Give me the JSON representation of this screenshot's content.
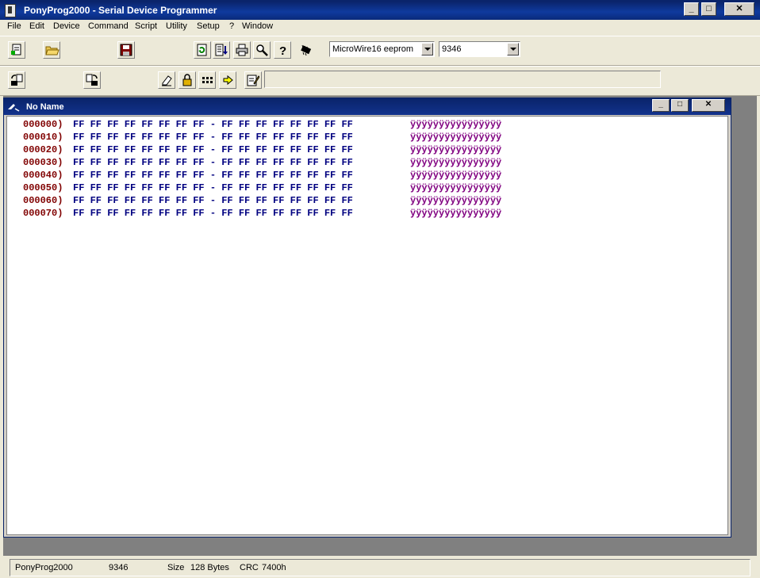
{
  "window": {
    "title": "PonyProg2000 - Serial Device Programmer",
    "minimize": "_",
    "maximize": "□",
    "close": "✕"
  },
  "menu": {
    "items": [
      "File",
      "Edit",
      "Device",
      "Command",
      "Script",
      "Utility",
      "Setup",
      "?",
      "Window"
    ]
  },
  "toolbar": {
    "device_family": "MicroWire16 eeprom",
    "device_type": "9346",
    "note_text": ""
  },
  "document": {
    "title": "No Name",
    "rows": [
      {
        "addr": "000000)",
        "bytes": "FF FF FF FF FF FF FF FF - FF FF FF FF FF FF FF FF",
        "ascii": "ÿÿÿÿÿÿÿÿÿÿÿÿÿÿÿÿ"
      },
      {
        "addr": "000010)",
        "bytes": "FF FF FF FF FF FF FF FF - FF FF FF FF FF FF FF FF",
        "ascii": "ÿÿÿÿÿÿÿÿÿÿÿÿÿÿÿÿ"
      },
      {
        "addr": "000020)",
        "bytes": "FF FF FF FF FF FF FF FF - FF FF FF FF FF FF FF FF",
        "ascii": "ÿÿÿÿÿÿÿÿÿÿÿÿÿÿÿÿ"
      },
      {
        "addr": "000030)",
        "bytes": "FF FF FF FF FF FF FF FF - FF FF FF FF FF FF FF FF",
        "ascii": "ÿÿÿÿÿÿÿÿÿÿÿÿÿÿÿÿ"
      },
      {
        "addr": "000040)",
        "bytes": "FF FF FF FF FF FF FF FF - FF FF FF FF FF FF FF FF",
        "ascii": "ÿÿÿÿÿÿÿÿÿÿÿÿÿÿÿÿ"
      },
      {
        "addr": "000050)",
        "bytes": "FF FF FF FF FF FF FF FF - FF FF FF FF FF FF FF FF",
        "ascii": "ÿÿÿÿÿÿÿÿÿÿÿÿÿÿÿÿ"
      },
      {
        "addr": "000060)",
        "bytes": "FF FF FF FF FF FF FF FF - FF FF FF FF FF FF FF FF",
        "ascii": "ÿÿÿÿÿÿÿÿÿÿÿÿÿÿÿÿ"
      },
      {
        "addr": "000070)",
        "bytes": "FF FF FF FF FF FF FF FF - FF FF FF FF FF FF FF FF",
        "ascii": "ÿÿÿÿÿÿÿÿÿÿÿÿÿÿÿÿ"
      }
    ]
  },
  "status": {
    "app": "PonyProg2000",
    "device": "9346",
    "size_label": "Size",
    "size_value": "128 Bytes",
    "crc_label": "CRC",
    "crc_value": "7400h"
  },
  "colors": {
    "title_bar": "#0a246a",
    "address": "#800000",
    "hex_bytes": "#000080",
    "ascii": "#800080"
  }
}
